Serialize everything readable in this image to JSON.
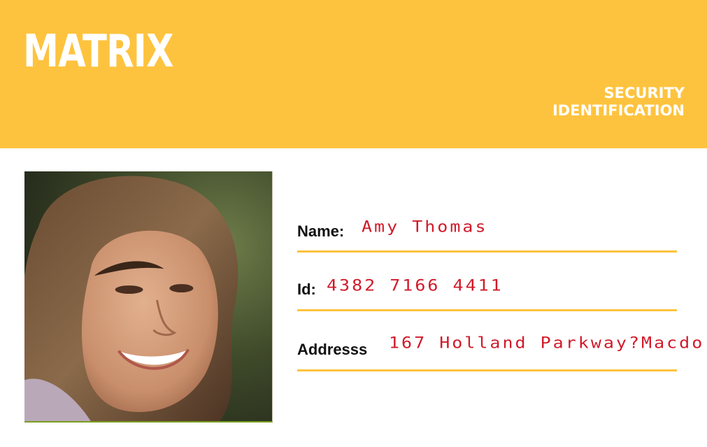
{
  "header": {
    "brand": "MATRIX",
    "doc_type_line1": "SECURITY",
    "doc_type_line2": "IDENTIFICATION"
  },
  "colors": {
    "accent": "#fec33e",
    "value_text": "#d11a2a",
    "label_text": "#111111"
  },
  "fields": {
    "name_label": "Name:",
    "name_value": "Amy Thomas",
    "id_label": "Id:",
    "id_value": "4382 7166 4411",
    "address_label": "Addresss",
    "address_value": "167 Holland Parkway?Macdo"
  },
  "photo": {
    "icon": "portrait-photo"
  }
}
